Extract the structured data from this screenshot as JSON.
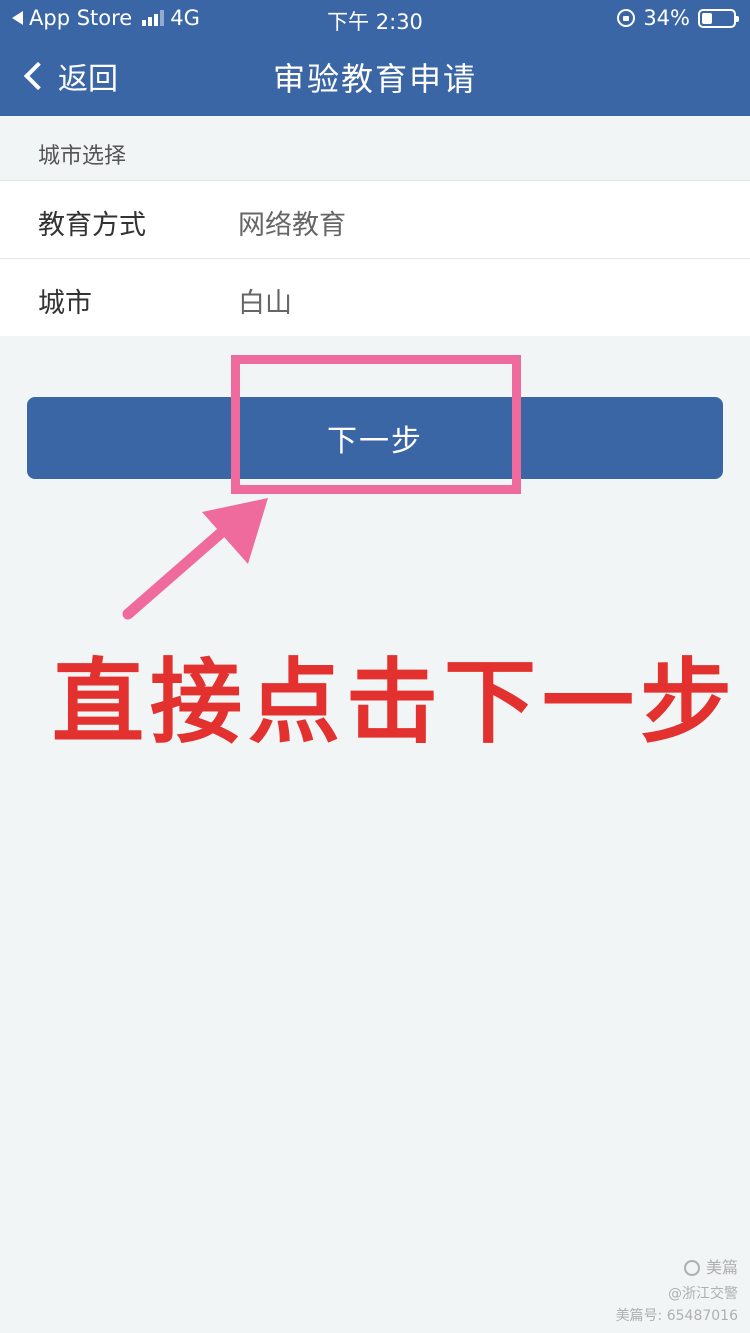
{
  "status_bar": {
    "back_app": "App Store",
    "network": "4G",
    "time": "下午 2:30",
    "battery": "34%",
    "battery_level": 0.34
  },
  "nav": {
    "back_label": "返回",
    "title": "审验教育申请"
  },
  "section": {
    "title": "城市选择"
  },
  "form": {
    "rows": [
      {
        "label": "教育方式",
        "value": "网络教育"
      },
      {
        "label": "城市",
        "value": "白山"
      }
    ]
  },
  "next_button": {
    "label": "下一步"
  },
  "annotation": {
    "text": "直接点击下一步",
    "highlight_color": "#ef6b9d",
    "text_color": "#e2312e"
  },
  "watermark": {
    "brand": "美篇",
    "line1": "@浙江交警",
    "line2": "美篇号: 65487016"
  },
  "colors": {
    "primary": "#3b66a6",
    "background": "#f1f5f5"
  }
}
